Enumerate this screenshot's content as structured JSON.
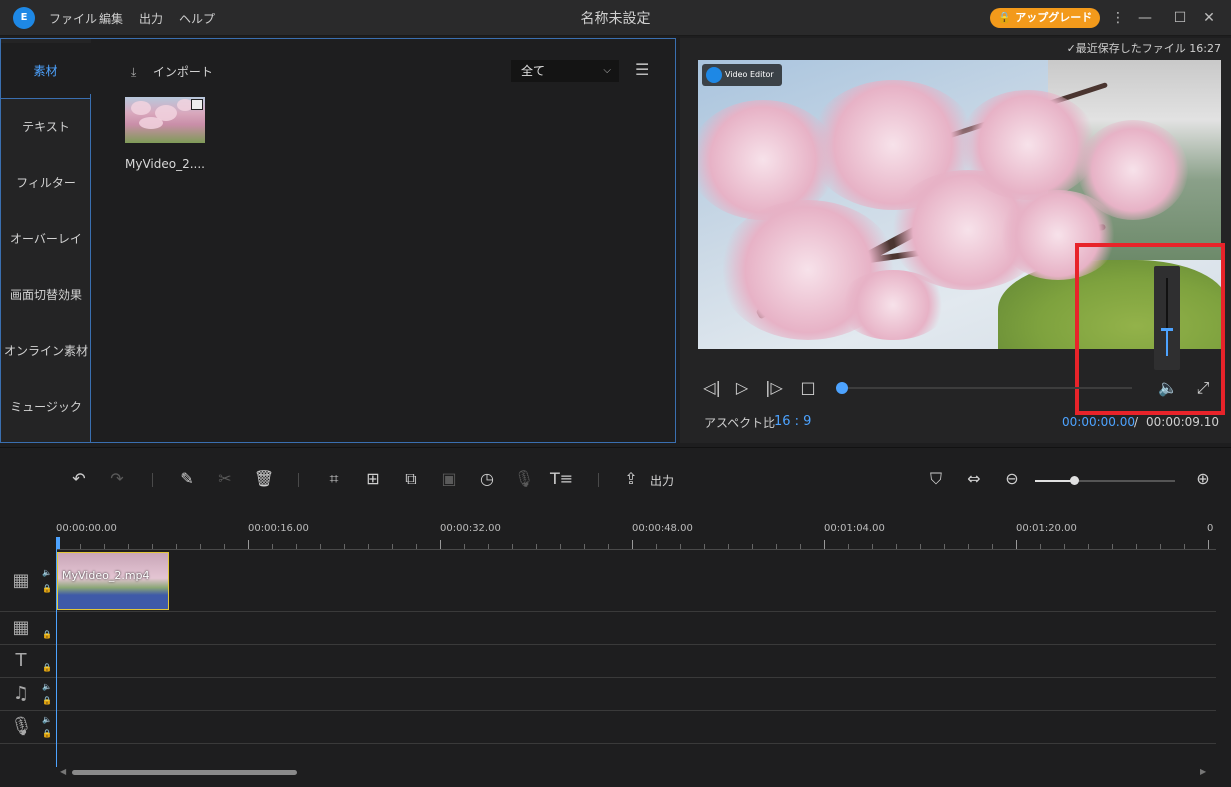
{
  "titlebar": {
    "app_title": "名称未設定",
    "menus": [
      "ファイル",
      "編集",
      "出力",
      "ヘルプ"
    ],
    "upgrade_label": "🔒 アップグレード"
  },
  "sidebar": {
    "items": [
      "素材",
      "テキスト",
      "フィルター",
      "オーバーレイ",
      "画面切替効果",
      "オンライン素材",
      "ミュージック"
    ],
    "active": "素材"
  },
  "media": {
    "import_label": "インポート",
    "filter_value": "全て",
    "items": [
      {
        "name": "MyVideo_2...."
      }
    ]
  },
  "preview": {
    "saved_label": "✓最近保存したファイル 16:27",
    "badge": "Video Editor",
    "aspect_label": "アスペクト比",
    "aspect_value": "16 : 9",
    "time_current": "00:00:00.00",
    "time_sep": "/",
    "time_total": "00:00:09.10",
    "volume_level": 0.35,
    "seek_progress": 0.0
  },
  "toolbar": {
    "export_label": "出力",
    "zoom_level": 0.28
  },
  "timeline": {
    "ruler_labels": [
      "00:00:00.00",
      "00:00:16.00",
      "00:00:32.00",
      "00:00:48.00",
      "00:01:04.00",
      "00:01:20.00",
      "0"
    ],
    "clip_name": "MyVideo_2.mp4"
  },
  "colors": {
    "accent": "#4da3ff",
    "upgrade": "#f39a1b",
    "highlight": "#e8232a"
  }
}
